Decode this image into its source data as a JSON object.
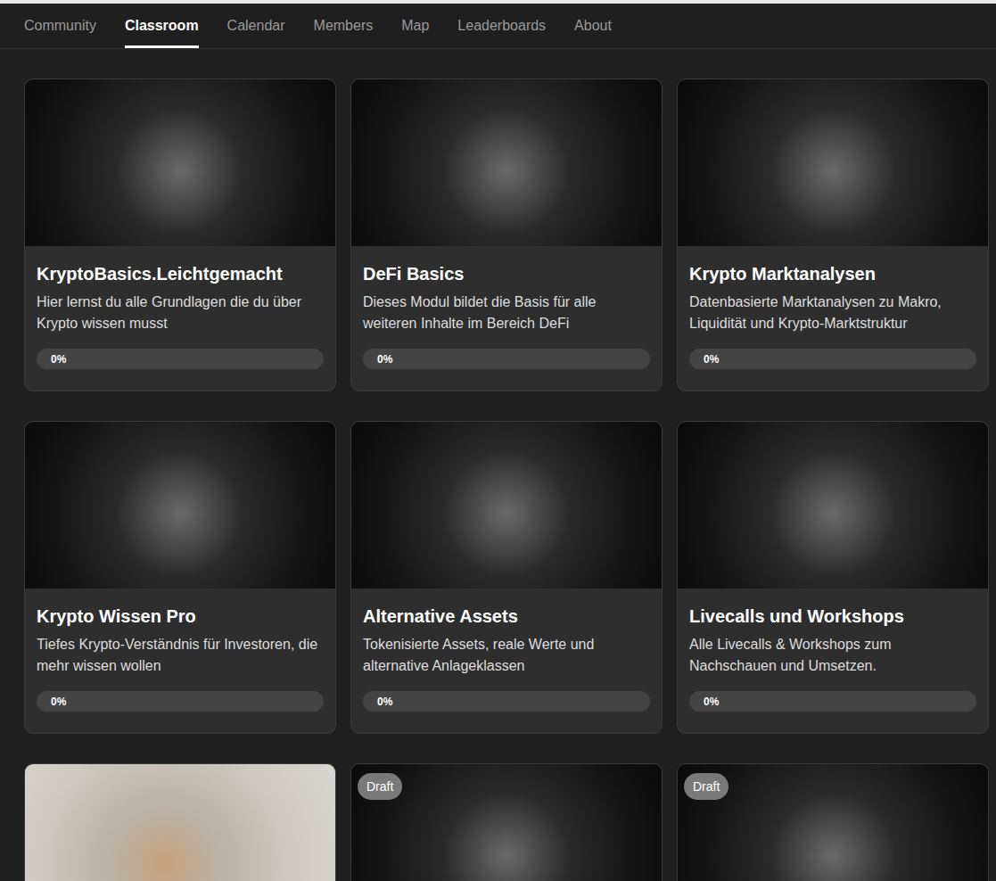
{
  "tabs": [
    {
      "label": "Community",
      "selected": false
    },
    {
      "label": "Classroom",
      "selected": true
    },
    {
      "label": "Calendar",
      "selected": false
    },
    {
      "label": "Members",
      "selected": false
    },
    {
      "label": "Map",
      "selected": false
    },
    {
      "label": "Leaderboards",
      "selected": false
    },
    {
      "label": "About",
      "selected": false
    }
  ],
  "courses": [
    {
      "title": "KryptoBasics.Leichtgemacht",
      "description": "Hier lernst du alle Grundlagen die du über Krypto wissen musst",
      "progress": "0%",
      "level": 0,
      "draft": false
    },
    {
      "title": "DeFi Basics",
      "description": "Dieses Modul bildet die Basis für alle weiteren Inhalte im Bereich DeFi",
      "progress": "0%",
      "level": 0,
      "draft": false
    },
    {
      "title": "Krypto Marktanalysen",
      "description": "Datenbasierte Marktanalysen zu Makro, Liquidität und Krypto-Marktstruktur",
      "progress": "0%",
      "level": 0,
      "draft": false
    },
    {
      "title": "Krypto Wissen Pro",
      "description": "Tiefes Krypto-Verständnis für Investoren, die mehr wissen wollen",
      "progress": "0%",
      "level": 0,
      "draft": false
    },
    {
      "title": "Alternative Assets",
      "description": "Tokenisierte Assets, reale Werte und alternative Anlageklassen",
      "progress": "0%",
      "level": 0,
      "draft": false
    },
    {
      "title": "Livecalls und Workshops",
      "description": "Alle Livecalls & Workshops zum Nachschauen und Umsetzen.",
      "progress": "0%",
      "level": 0,
      "draft": false
    },
    {
      "draft": false
    },
    {
      "draft": true,
      "badge": "Draft"
    },
    {
      "draft": true,
      "badge": "Draft"
    }
  ]
}
